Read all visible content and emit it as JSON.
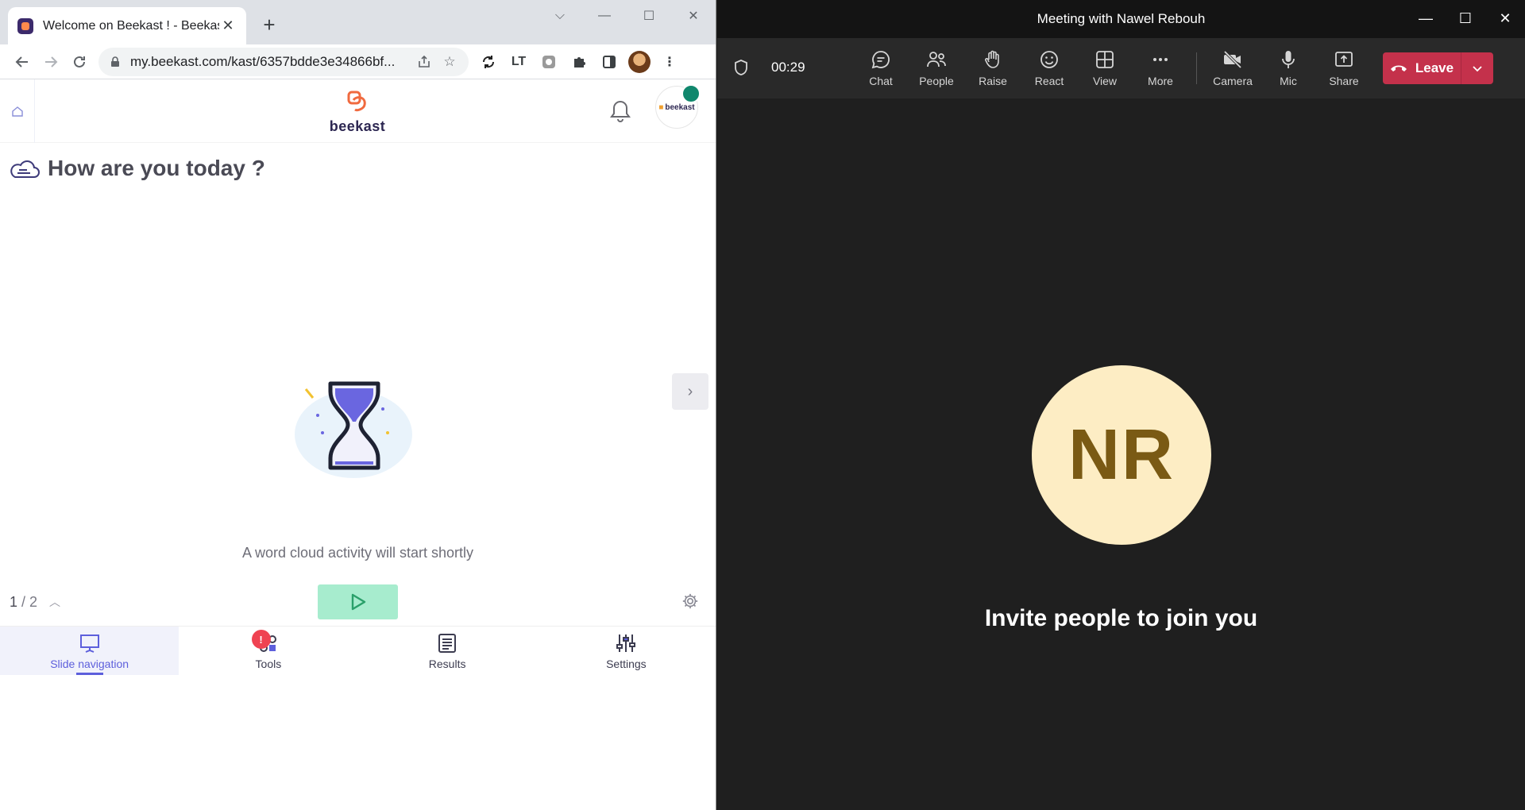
{
  "browser": {
    "tab_title": "Welcome on Beekast ! - Beekast",
    "url": "my.beekast.com/kast/6357bdde3e34866bf...",
    "ext_lt": "LT"
  },
  "beekast": {
    "logo_text": "beekast",
    "org_label": "beekast",
    "question": "How are you today ?",
    "waiting_text": "A word cloud activity will start shortly",
    "slide_current": "1",
    "slide_total": "/ 2",
    "nav": [
      {
        "label": "Slide navigation"
      },
      {
        "label": "Tools",
        "badge": "!"
      },
      {
        "label": "Results"
      },
      {
        "label": "Settings"
      }
    ],
    "colors": {
      "accent": "#5d5fdc",
      "play": "#a7ecce",
      "badge": "#ef4352",
      "brand": "#2d2752"
    }
  },
  "teams": {
    "title": "Meeting with Nawel Rebouh",
    "timer": "00:29",
    "toolbar": [
      {
        "label": "Chat"
      },
      {
        "label": "People"
      },
      {
        "label": "Raise"
      },
      {
        "label": "React"
      },
      {
        "label": "View"
      },
      {
        "label": "More"
      },
      {
        "label": "Camera"
      },
      {
        "label": "Mic"
      },
      {
        "label": "Share"
      }
    ],
    "leave_label": "Leave",
    "avatar_initials": "NR",
    "invite_text": "Invite people to join you",
    "colors": {
      "leave": "#c4314b",
      "avatar_bg": "#fdedc4",
      "avatar_text": "#7a5a14"
    }
  }
}
